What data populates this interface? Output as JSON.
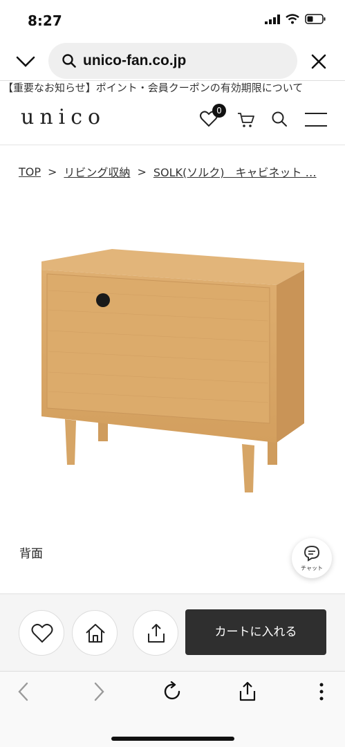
{
  "status": {
    "time": "8:27"
  },
  "browser": {
    "url": "unico-fan.co.jp"
  },
  "notice": {
    "text": "【重要なお知らせ】ポイント・会員クーポンの有効期限について"
  },
  "header": {
    "logo": "unico",
    "favorites_count": "0"
  },
  "breadcrumb": {
    "items": [
      "TOP",
      "リビング収納",
      "SOLK(ソルク)　キャビネット …"
    ],
    "separator": ">"
  },
  "product": {
    "image_caption": "背面"
  },
  "chat": {
    "label": "チャット"
  },
  "actions": {
    "cart_label": "カートに入れる"
  },
  "colors": {
    "wood": "#d9a868",
    "cart_button": "#2f2f2f"
  },
  "icons": [
    "chevron-down-icon",
    "search-icon",
    "close-icon",
    "heart-icon",
    "cart-icon",
    "menu-icon",
    "chat-icon",
    "home-icon",
    "share-icon",
    "back-icon",
    "forward-icon",
    "reload-icon",
    "more-icon"
  ]
}
